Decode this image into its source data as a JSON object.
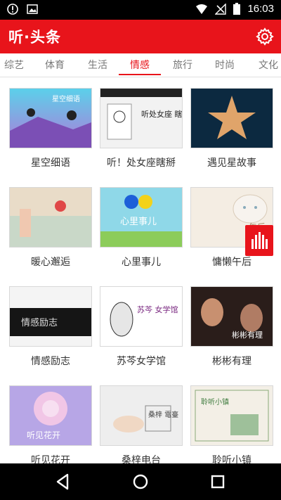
{
  "status_bar": {
    "time": "16:03"
  },
  "app_bar": {
    "title": "听·头条"
  },
  "tabs": [
    {
      "label": "综艺",
      "active": false
    },
    {
      "label": "体育",
      "active": false
    },
    {
      "label": "生活",
      "active": false
    },
    {
      "label": "情感",
      "active": true
    },
    {
      "label": "旅行",
      "active": false
    },
    {
      "label": "时尚",
      "active": false
    },
    {
      "label": "文化",
      "active": false
    }
  ],
  "cards": [
    {
      "title": "星空细语",
      "thumb_text": "星空细语"
    },
    {
      "title": "听！处女座瞎掰",
      "thumb_text": "听处女座 瞎掰!"
    },
    {
      "title": "遇见星故事",
      "thumb_text": ""
    },
    {
      "title": "暖心邂逅",
      "thumb_text": ""
    },
    {
      "title": "心里事儿",
      "thumb_text": "心里事儿"
    },
    {
      "title": "慵懒午后",
      "thumb_text": "午后"
    },
    {
      "title": "情感励志",
      "thumb_text": "情感励志"
    },
    {
      "title": "苏芩女学馆",
      "thumb_text": "苏芩 女学馆"
    },
    {
      "title": "彬彬有理",
      "thumb_text": "彬彬有理"
    },
    {
      "title": "听见花开",
      "thumb_text": "听见花开"
    },
    {
      "title": "桑梓电台",
      "thumb_text": "桑梓 電臺"
    },
    {
      "title": "聆听小镇",
      "thumb_text": "聆听小镇"
    }
  ],
  "colors": {
    "accent": "#e8141b"
  }
}
